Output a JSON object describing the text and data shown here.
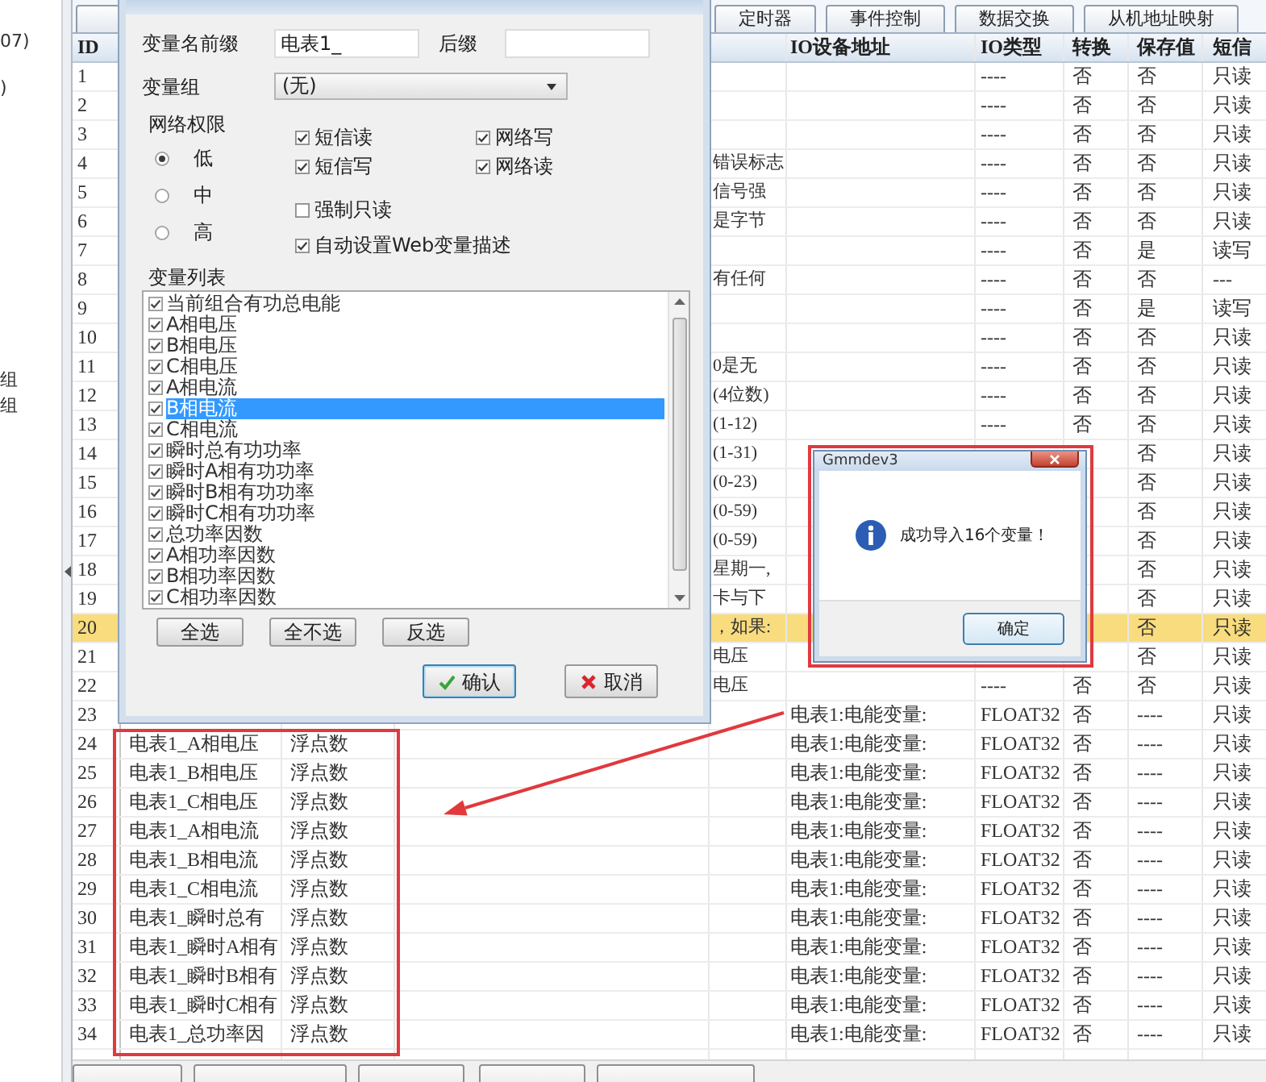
{
  "sidebar": {
    "top_items": [
      {
        "label": "07)"
      },
      {
        "label": ")"
      }
    ],
    "lower_items": [
      {
        "label": "组"
      },
      {
        "label": "组"
      }
    ]
  },
  "tabs": [
    {
      "label": "定时器",
      "selected": false
    },
    {
      "label": "事件控制",
      "selected": false
    },
    {
      "label": "数据交换",
      "selected": false
    },
    {
      "label": "从机地址映射",
      "selected": false
    }
  ],
  "table": {
    "header": {
      "id": "ID",
      "io_address": "IO设备地址",
      "io_type": "IO类型",
      "convert": "转换",
      "save_value": "保存值",
      "sms_read": "短信"
    },
    "rows": [
      {
        "id": "1",
        "selected": false,
        "io_type": "----",
        "convert": "否",
        "save_value": "否",
        "sms_read": "只读"
      },
      {
        "id": "2",
        "selected": false,
        "io_type": "----",
        "convert": "否",
        "save_value": "否",
        "sms_read": "只读"
      },
      {
        "id": "3",
        "selected": false,
        "io_type": "----",
        "convert": "否",
        "save_value": "否",
        "sms_read": "只读"
      },
      {
        "id": "4",
        "selected": false,
        "column_4": "错误标志",
        "io_type": "----",
        "convert": "否",
        "save_value": "否",
        "sms_read": "只读"
      },
      {
        "id": "5",
        "selected": false,
        "column_4": "信号强",
        "io_type": "----",
        "convert": "否",
        "save_value": "否",
        "sms_read": "只读"
      },
      {
        "id": "6",
        "selected": false,
        "column_4": "是字节",
        "io_type": "----",
        "convert": "否",
        "save_value": "否",
        "sms_read": "只读"
      },
      {
        "id": "7",
        "selected": false,
        "io_type": "----",
        "convert": "否",
        "save_value": "是",
        "sms_read": "读写"
      },
      {
        "id": "8",
        "selected": false,
        "column_4": "有任何",
        "io_type": "----",
        "convert": "否",
        "save_value": "否",
        "sms_read": "---"
      },
      {
        "id": "9",
        "selected": false,
        "io_type": "----",
        "convert": "否",
        "save_value": "是",
        "sms_read": "读写"
      },
      {
        "id": "10",
        "selected": false,
        "io_type": "----",
        "convert": "否",
        "save_value": "否",
        "sms_read": "只读"
      },
      {
        "id": "11",
        "selected": false,
        "column_4": "0是无",
        "io_type": "----",
        "convert": "否",
        "save_value": "否",
        "sms_read": "只读"
      },
      {
        "id": "12",
        "selected": false,
        "column_4": "(4位数)",
        "io_type": "----",
        "convert": "否",
        "save_value": "否",
        "sms_read": "只读"
      },
      {
        "id": "13",
        "selected": false,
        "column_4": "(1-12)",
        "io_type": "----",
        "convert": "否",
        "save_value": "否",
        "sms_read": "只读"
      },
      {
        "id": "14",
        "selected": false,
        "column_4": "(1-31)",
        "save_value": "否",
        "sms_read": "只读"
      },
      {
        "id": "15",
        "selected": false,
        "column_4": "(0-23)",
        "save_value": "否",
        "sms_read": "只读"
      },
      {
        "id": "16",
        "selected": false,
        "column_4": "(0-59)",
        "save_value": "否",
        "sms_read": "只读"
      },
      {
        "id": "17",
        "selected": false,
        "column_4": "(0-59)",
        "save_value": "否",
        "sms_read": "只读"
      },
      {
        "id": "18",
        "selected": false,
        "column_4": "星期一,",
        "save_value": "否",
        "sms_read": "只读"
      },
      {
        "id": "19",
        "selected": false,
        "column_4": "卡与下",
        "save_value": "否",
        "sms_read": "只读"
      },
      {
        "id": "20",
        "selected": true,
        "column_4": "，如果:",
        "save_value": "否",
        "sms_read": "只读"
      },
      {
        "id": "21",
        "selected": false,
        "column_4": "电压",
        "save_value": "否",
        "sms_read": "只读"
      },
      {
        "id": "22",
        "selected": false,
        "column_4": "电压",
        "io_type": "----",
        "convert": "否",
        "save_value": "否",
        "sms_read": "只读"
      },
      {
        "id": "23",
        "selected": false,
        "io_address": "电表1:电能变量:",
        "io_type": "FLOAT32",
        "convert": "否",
        "save_value": "----",
        "sms_read": "只读"
      },
      {
        "id": "24",
        "selected": false,
        "column_2": "电表1_A相电压",
        "column_3": "浮点数",
        "io_address": "电表1:电能变量:",
        "io_type": "FLOAT32",
        "convert": "否",
        "save_value": "----",
        "sms_read": "只读"
      },
      {
        "id": "25",
        "selected": false,
        "column_2": "电表1_B相电压",
        "column_3": "浮点数",
        "io_address": "电表1:电能变量:",
        "io_type": "FLOAT32",
        "convert": "否",
        "save_value": "----",
        "sms_read": "只读"
      },
      {
        "id": "26",
        "selected": false,
        "column_2": "电表1_C相电压",
        "column_3": "浮点数",
        "io_address": "电表1:电能变量:",
        "io_type": "FLOAT32",
        "convert": "否",
        "save_value": "----",
        "sms_read": "只读"
      },
      {
        "id": "27",
        "selected": false,
        "column_2": "电表1_A相电流",
        "column_3": "浮点数",
        "io_address": "电表1:电能变量:",
        "io_type": "FLOAT32",
        "convert": "否",
        "save_value": "----",
        "sms_read": "只读"
      },
      {
        "id": "28",
        "selected": false,
        "column_2": "电表1_B相电流",
        "column_3": "浮点数",
        "io_address": "电表1:电能变量:",
        "io_type": "FLOAT32",
        "convert": "否",
        "save_value": "----",
        "sms_read": "只读"
      },
      {
        "id": "29",
        "selected": false,
        "column_2": "电表1_C相电流",
        "column_3": "浮点数",
        "io_address": "电表1:电能变量:",
        "io_type": "FLOAT32",
        "convert": "否",
        "save_value": "----",
        "sms_read": "只读"
      },
      {
        "id": "30",
        "selected": false,
        "column_2": "电表1_瞬时总有",
        "column_3": "浮点数",
        "io_address": "电表1:电能变量:",
        "io_type": "FLOAT32",
        "convert": "否",
        "save_value": "----",
        "sms_read": "只读"
      },
      {
        "id": "31",
        "selected": false,
        "column_2": "电表1_瞬时A相有",
        "column_3": "浮点数",
        "io_address": "电表1:电能变量:",
        "io_type": "FLOAT32",
        "convert": "否",
        "save_value": "----",
        "sms_read": "只读"
      },
      {
        "id": "32",
        "selected": false,
        "column_2": "电表1_瞬时B相有",
        "column_3": "浮点数",
        "io_address": "电表1:电能变量:",
        "io_type": "FLOAT32",
        "convert": "否",
        "save_value": "----",
        "sms_read": "只读"
      },
      {
        "id": "33",
        "selected": false,
        "column_2": "电表1_瞬时C相有",
        "column_3": "浮点数",
        "io_address": "电表1:电能变量:",
        "io_type": "FLOAT32",
        "convert": "否",
        "save_value": "----",
        "sms_read": "只读"
      },
      {
        "id": "34",
        "selected": false,
        "column_2": "电表1_总功率因",
        "column_3": "浮点数",
        "io_address": "电表1:电能变量:",
        "io_type": "FLOAT32",
        "convert": "否",
        "save_value": "----",
        "sms_read": "只读"
      }
    ]
  },
  "import_dialog": {
    "prefix_label": "变量名前缀",
    "prefix_value": "电表1_",
    "suffix_label": "后缀",
    "group_label": "变量组",
    "group_value": "(无)",
    "permission_label": "网络权限",
    "permission_options": [
      {
        "label": "低",
        "selected": true
      },
      {
        "label": "中",
        "selected": false
      },
      {
        "label": "高",
        "selected": false
      }
    ],
    "options": [
      {
        "label": "短信读",
        "checked": true
      },
      {
        "label": "网络写",
        "checked": true
      },
      {
        "label": "短信写",
        "checked": true
      },
      {
        "label": "网络读",
        "checked": true
      }
    ],
    "more_options": [
      {
        "label": "强制只读",
        "checked": false
      },
      {
        "label": "自动设置Web变量描述",
        "checked": true
      }
    ],
    "list_label": "变量列表",
    "variables": [
      {
        "label": "当前组合有功总电能",
        "checked": true,
        "selected": false
      },
      {
        "label": "A相电压",
        "checked": true,
        "selected": false
      },
      {
        "label": "B相电压",
        "checked": true,
        "selected": false
      },
      {
        "label": "C相电压",
        "checked": true,
        "selected": false
      },
      {
        "label": "A相电流",
        "checked": true,
        "selected": false
      },
      {
        "label": "B相电流",
        "checked": true,
        "selected": true
      },
      {
        "label": "C相电流",
        "checked": true,
        "selected": false
      },
      {
        "label": "瞬时总有功功率",
        "checked": true,
        "selected": false
      },
      {
        "label": "瞬时A相有功功率",
        "checked": true,
        "selected": false
      },
      {
        "label": "瞬时B相有功功率",
        "checked": true,
        "selected": false
      },
      {
        "label": "瞬时C相有功功率",
        "checked": true,
        "selected": false
      },
      {
        "label": "总功率因数",
        "checked": true,
        "selected": false
      },
      {
        "label": "A相功率因数",
        "checked": true,
        "selected": false
      },
      {
        "label": "B相功率因数",
        "checked": true,
        "selected": false
      },
      {
        "label": "C相功率因数",
        "checked": true,
        "selected": false
      }
    ],
    "list_buttons": [
      "全选",
      "全不选",
      "反选"
    ],
    "confirm_button": "确认",
    "cancel_button": "取消"
  },
  "message_dialog": {
    "title": "Gmmdev3",
    "message": "成功导入16个变量！",
    "button": "确定"
  }
}
